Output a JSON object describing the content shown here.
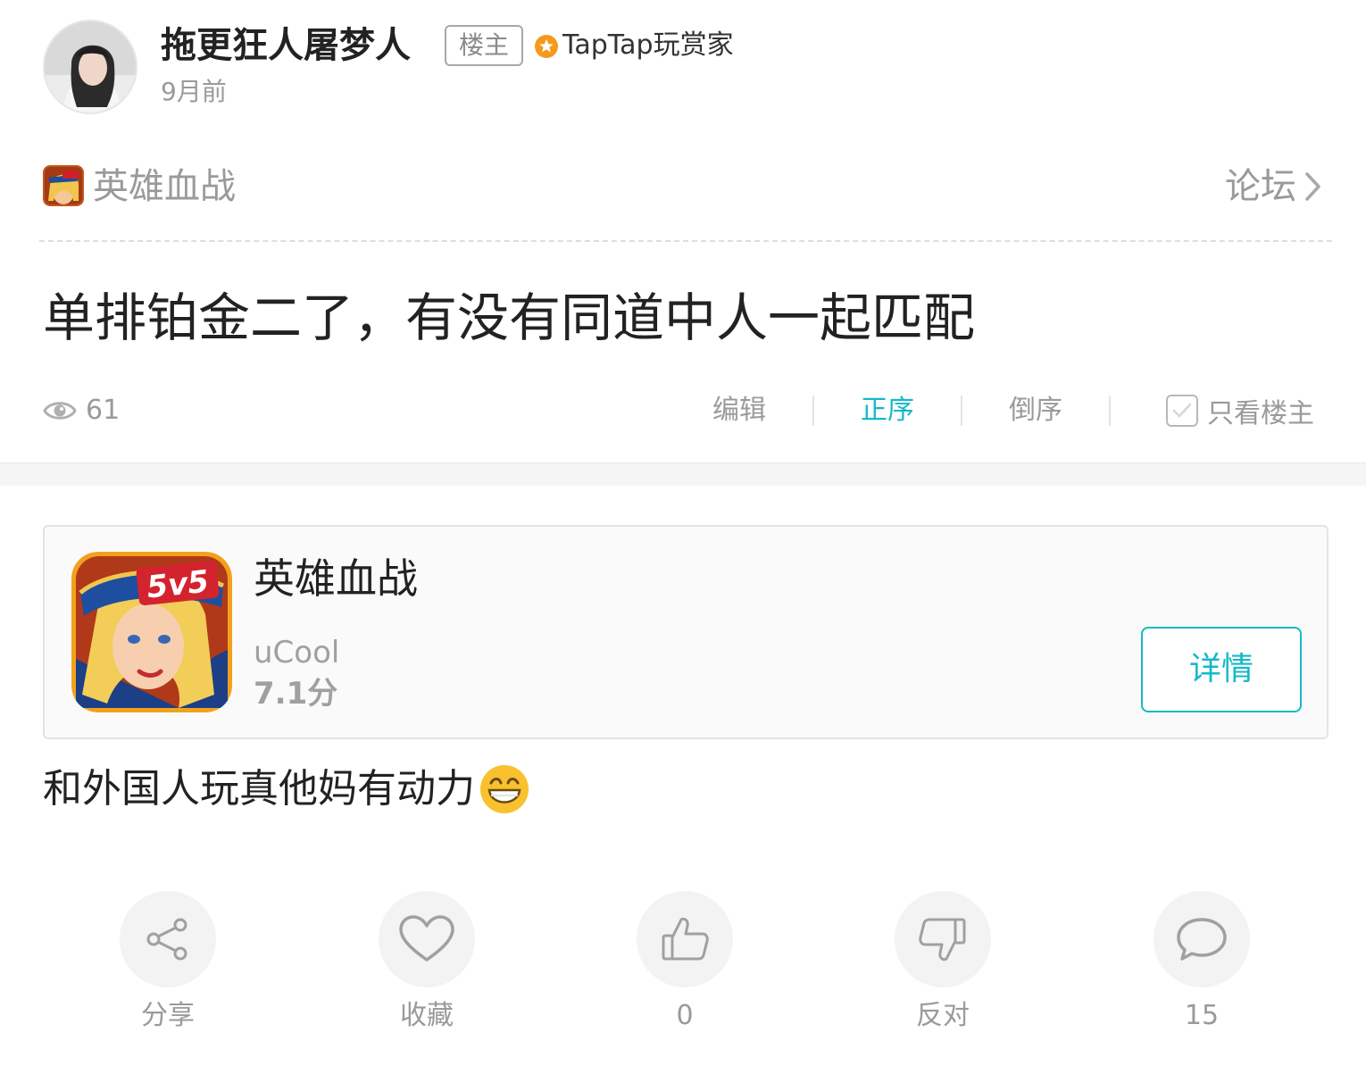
{
  "author": {
    "name": "拖更狂人屠梦人",
    "op_badge": "楼主",
    "title_badge": "TapTap玩赏家",
    "time": "9月前"
  },
  "forum": {
    "game_name": "英雄血战",
    "link_label": "论坛"
  },
  "post": {
    "title": "单排铂金二了，有没有同道中人一起匹配",
    "views": "61",
    "body": "和外国人玩真他妈有动力"
  },
  "toolbar": {
    "edit": "编辑",
    "order_asc": "正序",
    "order_desc": "倒序",
    "only_op": "只看楼主"
  },
  "app_card": {
    "icon_text": "5v5",
    "name": "英雄血战",
    "developer": "uCool",
    "score": "7.1分",
    "detail_button": "详情"
  },
  "bottom_bar": {
    "share": "分享",
    "favorite": "收藏",
    "like_count": "0",
    "oppose": "反对",
    "comment_count": "15"
  },
  "colors": {
    "accent": "#14b9c8",
    "muted": "#9a9a9a",
    "badge_orange": "#f39a1e"
  }
}
